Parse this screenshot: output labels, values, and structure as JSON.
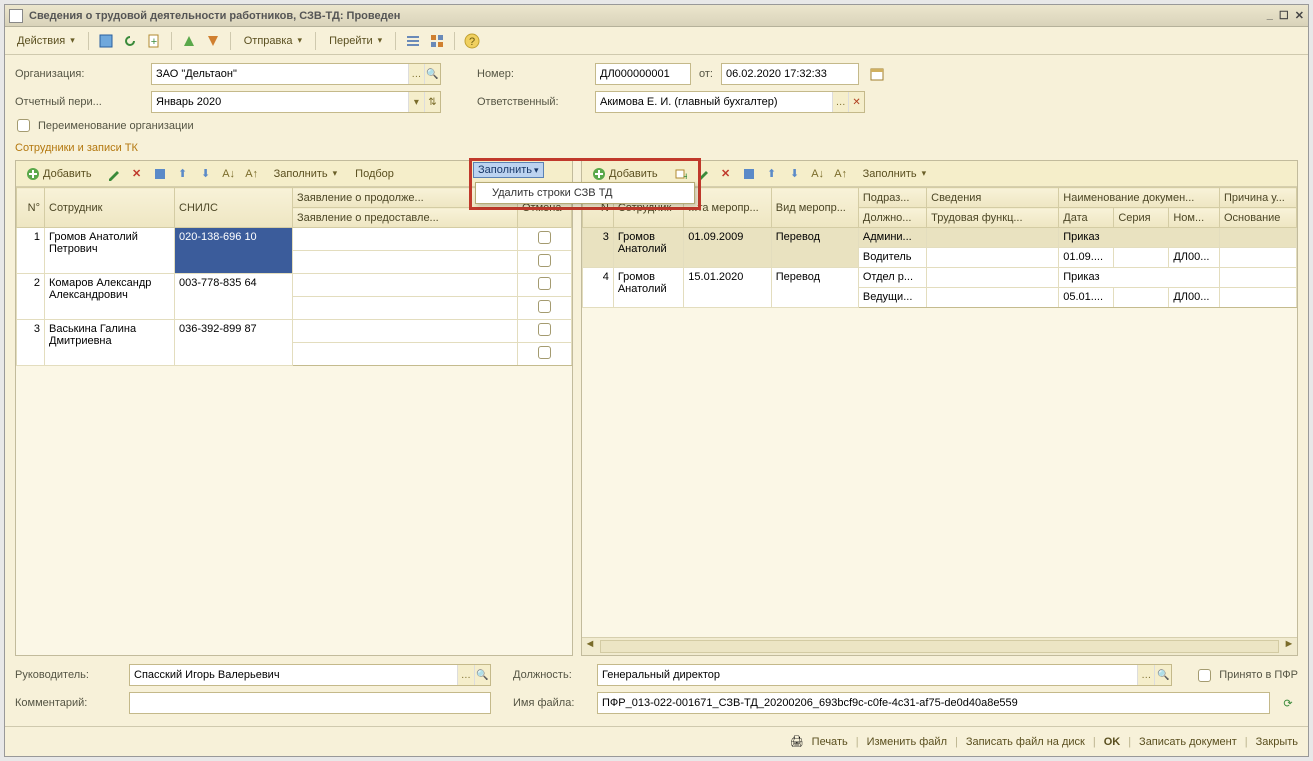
{
  "window": {
    "title": "Сведения о трудовой деятельности работников, СЗВ-ТД: Проведен"
  },
  "toolbar": {
    "actions": "Действия",
    "send": "Отправка",
    "goto": "Перейти"
  },
  "header": {
    "org_label": "Организация:",
    "org_value": "ЗАО \"Дельтаон\"",
    "number_label": "Номер:",
    "number_value": "ДЛ000000001",
    "from_label": "от:",
    "date_value": "06.02.2020 17:32:33",
    "period_label": "Отчетный пери...",
    "period_value": "Январь 2020",
    "responsible_label": "Ответственный:",
    "responsible_value": "Акимова Е. И. (главный бухгалтер)",
    "rename_checkbox": "Переименование организации"
  },
  "section_title": "Сотрудники и записи ТК",
  "left_toolbar": {
    "add": "Добавить",
    "fill": "Заполнить",
    "select": "Подбор"
  },
  "dropdown": {
    "trigger": "Заполнить",
    "item1": "Удалить строки СЗВ ТД"
  },
  "right_toolbar": {
    "add": "Добавить",
    "fill": "Заполнить"
  },
  "left_table": {
    "head": {
      "n": "N°",
      "emp": "Сотрудник",
      "snils": "СНИЛС",
      "stmt1": "Заявление о продолже...",
      "stmt2": "Заявление о предоставле...",
      "cancel": "Отмена"
    },
    "rows": [
      {
        "n": "1",
        "emp": "Громов Анатолий Петрович",
        "snils": "020-138-696 10"
      },
      {
        "n": "2",
        "emp": "Комаров Александр Александрович",
        "snils": "003-778-835 64"
      },
      {
        "n": "3",
        "emp": "Васькина Галина Дмитриевна",
        "snils": "036-392-899 87"
      }
    ]
  },
  "right_table": {
    "head": {
      "n": "N",
      "emp": "Сотрудник",
      "date_ev": "...та меропр...",
      "type_ev": "Вид меропр...",
      "dept": "Подраз...",
      "pos": "Должно...",
      "info": "Сведения",
      "func": "Трудовая функц...",
      "docname": "Наименование докумен...",
      "date": "Дата",
      "series": "Серия",
      "num": "Ном...",
      "reason": "Причина у...",
      "basis": "Основание"
    },
    "rows": [
      {
        "n": "3",
        "emp": "Громов Анатолий",
        "date_ev": "01.09.2009",
        "type_ev": "Перевод",
        "dept": "Админи...",
        "pos": "Водитель",
        "docname": "Приказ",
        "date": "01.09....",
        "num": "ДЛ00..."
      },
      {
        "n": "4",
        "emp": "Громов Анатолий",
        "date_ev": "15.01.2020",
        "type_ev": "Перевод",
        "dept": "Отдел р...",
        "pos": "Ведущи...",
        "docname": "Приказ",
        "date": "05.01....",
        "num": "ДЛ00..."
      }
    ]
  },
  "bottom": {
    "leader_label": "Руководитель:",
    "leader_value": "Спасский Игорь Валерьевич",
    "position_label": "Должность:",
    "position_value": "Генеральный директор",
    "accepted": "Принято в ПФР",
    "comment_label": "Комментарий:",
    "comment_value": "",
    "filename_label": "Имя файла:",
    "filename_value": "ПФР_013-022-001671_СЗВ-ТД_20200206_693bcf9c-c0fe-4c31-af75-de0d40a8e559"
  },
  "footer": {
    "print": "Печать",
    "edit_file": "Изменить файл",
    "save_disk": "Записать файл на диск",
    "ok": "OK",
    "save_doc": "Записать документ",
    "close": "Закрыть"
  }
}
